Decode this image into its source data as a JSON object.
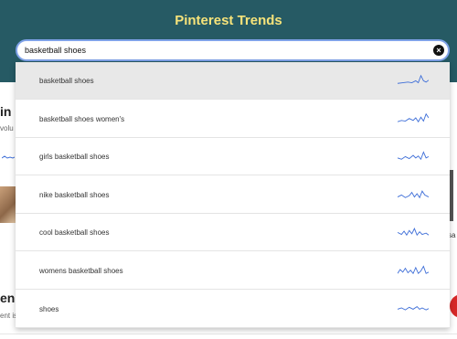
{
  "header": {
    "title": "Pinterest Trends"
  },
  "search": {
    "value": "basketball shoes",
    "clear_icon": "close-circle-icon"
  },
  "suggestions": [
    {
      "label": "basketball shoes",
      "selected": true
    },
    {
      "label": "basketball shoes women's",
      "selected": false
    },
    {
      "label": "girls basketball shoes",
      "selected": false
    },
    {
      "label": "nike basketball shoes",
      "selected": false
    },
    {
      "label": "cool basketball shoes",
      "selected": false
    },
    {
      "label": "womens basketball shoes",
      "selected": false
    },
    {
      "label": "shoes",
      "selected": false
    }
  ],
  "background": {
    "heading_1": "in",
    "subtext_1": "volu",
    "heading_2": "end",
    "subtext_2": "ent is",
    "right_text": "sa"
  },
  "colors": {
    "header_bg": "#265a64",
    "title": "#f6e37a",
    "search_border": "#7fa2e8",
    "sparkline": "#3f6fd8",
    "selected_row": "#e8e8e8",
    "action_button": "#d62828"
  }
}
